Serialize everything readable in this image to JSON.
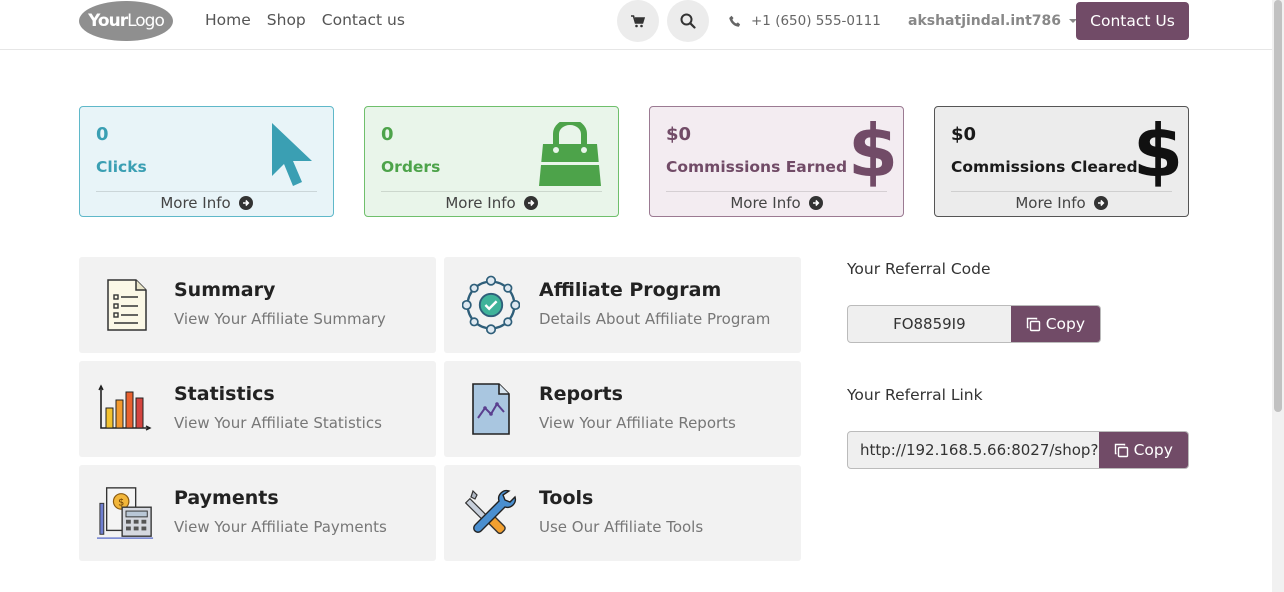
{
  "header": {
    "logo": {
      "bold": "Your",
      "rest": "Logo"
    },
    "nav": [
      "Home",
      "Shop",
      "Contact us"
    ],
    "phone": "+1 (650) 555-0111",
    "user": "akshatjindal.int786",
    "contact_button": "Contact Us"
  },
  "stats": [
    {
      "value": "0",
      "label": "Clicks",
      "more": "More Info",
      "color": "#3a9fb3",
      "bg": "#e8f4f8",
      "border": "#5fb8c9"
    },
    {
      "value": "0",
      "label": "Orders",
      "more": "More Info",
      "color": "#4da34a",
      "bg": "#e9f5ea",
      "border": "#6fbf6c"
    },
    {
      "value": "$0",
      "label": "Commissions Earned",
      "more": "More Info",
      "color": "#714b67",
      "bg": "#f3ecf1",
      "border": "#9b7a92"
    },
    {
      "value": "$0",
      "label": "Commissions Cleared",
      "more": "More Info",
      "color": "#1a1a1a",
      "bg": "#ececec",
      "border": "#555555"
    }
  ],
  "tiles": [
    {
      "title": "Summary",
      "subtitle": "View Your Affiliate Summary",
      "icon": "document-list-icon"
    },
    {
      "title": "Affiliate Program",
      "subtitle": "Details About Affiliate Program",
      "icon": "network-check-icon"
    },
    {
      "title": "Statistics",
      "subtitle": "View Your Affiliate Statistics",
      "icon": "bar-chart-icon"
    },
    {
      "title": "Reports",
      "subtitle": "View Your Affiliate Reports",
      "icon": "report-file-icon"
    },
    {
      "title": "Payments",
      "subtitle": "View Your Affiliate Payments",
      "icon": "payment-calculator-icon"
    },
    {
      "title": "Tools",
      "subtitle": "Use Our Affiliate Tools",
      "icon": "wrench-screwdriver-icon"
    }
  ],
  "referral": {
    "code_label": "Your Referral Code",
    "code": "FO8859I9",
    "link_label": "Your Referral Link",
    "link": "http://192.168.5.66:8027/shop?",
    "copy_label": "Copy"
  },
  "colors": {
    "brand": "#714b67"
  }
}
